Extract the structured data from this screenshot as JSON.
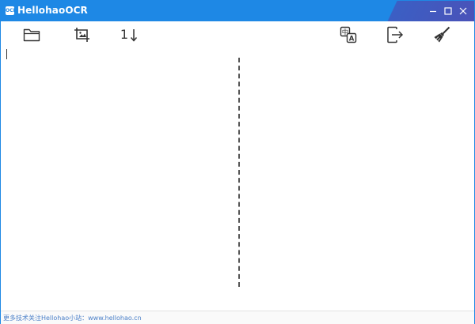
{
  "window": {
    "title": "HellohaoOCR",
    "icon_label": "OCR",
    "title_bar_color": "#1e88e5",
    "accent_color": "#4a52b8"
  },
  "window_controls": {
    "minimize_icon": "minimize-icon",
    "maximize_icon": "maximize-icon",
    "close_icon": "close-icon"
  },
  "toolbar": {
    "left_tools": [
      {
        "icon": "folder-icon",
        "tooltip": ""
      },
      {
        "icon": "crop-image-icon",
        "tooltip": ""
      },
      {
        "icon": "sort-icon",
        "tooltip": ""
      }
    ],
    "right_tools": [
      {
        "icon": "translate-icon",
        "tooltip": ""
      },
      {
        "icon": "export-icon",
        "tooltip": ""
      },
      {
        "icon": "broom-clear-icon",
        "tooltip": ""
      }
    ],
    "sort_label": "1"
  },
  "translate_icon": {
    "source_glyph": "中",
    "target_glyph": "A"
  },
  "content": {
    "left_text": "",
    "right_text": ""
  },
  "statusbar": {
    "text": "更多技术关注Hellohao小站：www.hellohao.cn"
  }
}
